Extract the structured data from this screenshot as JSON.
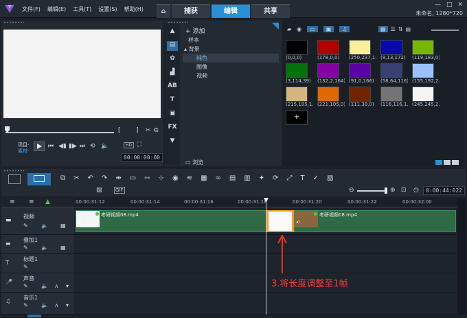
{
  "menu": [
    "文件(F)",
    "编辑(E)",
    "工具(T)",
    "设置(S)",
    "帮助(H)"
  ],
  "tabs": {
    "home": "⌂",
    "capture": "捕获",
    "edit": "编辑",
    "share": "共享"
  },
  "window": {
    "min": "—",
    "max": "□",
    "close": "✕",
    "project_info": "未命名, 1280*720"
  },
  "preview": {
    "bracket_left": "[",
    "bracket_right": "]",
    "mode_project": "项目-",
    "mode_clip": "素材-",
    "zoom_label": "HD",
    "timecode": "00:00:00:00"
  },
  "library": {
    "add_label": "添加",
    "tree": [
      "样本",
      "背景",
      "纯色",
      "图像",
      "视频"
    ],
    "browse_label": "浏览"
  },
  "colors": [
    {
      "hex": "#000000",
      "label": "(0,0,0)"
    },
    {
      "hex": "#b20000",
      "label": "(178,0,0)"
    },
    {
      "hex": "#faed9e",
      "label": "(250,237,1..."
    },
    {
      "hex": "#0909ac",
      "label": "(9,13,172)"
    },
    {
      "hex": "#77b700",
      "label": "(119,183,0)"
    },
    {
      "hex": "#03720c",
      "label": "(3,114,39)"
    },
    {
      "hex": "#8402a4",
      "label": "(132,2,164)"
    },
    {
      "hex": "#5b00a6",
      "label": "(91,0,166)"
    },
    {
      "hex": "#3a4074",
      "label": "(58,64,116)"
    },
    {
      "hex": "#9bc0ff",
      "label": "(155,192,2..."
    },
    {
      "hex": "#d7b57e",
      "label": "(215,185,1..."
    },
    {
      "hex": "#dd6900",
      "label": "(221,105,0)"
    },
    {
      "hex": "#6f2600",
      "label": "(111,38,0)"
    },
    {
      "hex": "#747474",
      "label": "(116,116,1..."
    },
    {
      "hex": "#f5f5f5",
      "label": "(245,245,2..."
    },
    {
      "hex": "#000000",
      "label": "+"
    }
  ],
  "timeline": {
    "timecode": "0:00:44:022",
    "ruler": [
      "00:00:31:12",
      "00:00:31:14",
      "00:00:31:16",
      "00:00:31:18",
      "00:00:31:20",
      "00:00:31:22",
      "00:00:32:00"
    ],
    "tracks": [
      "视频",
      "叠加1",
      "标题1",
      "声音",
      "音乐1"
    ],
    "clip_name": "考研视频08.mp4",
    "annotation": "3.将长度调整至1帧"
  }
}
